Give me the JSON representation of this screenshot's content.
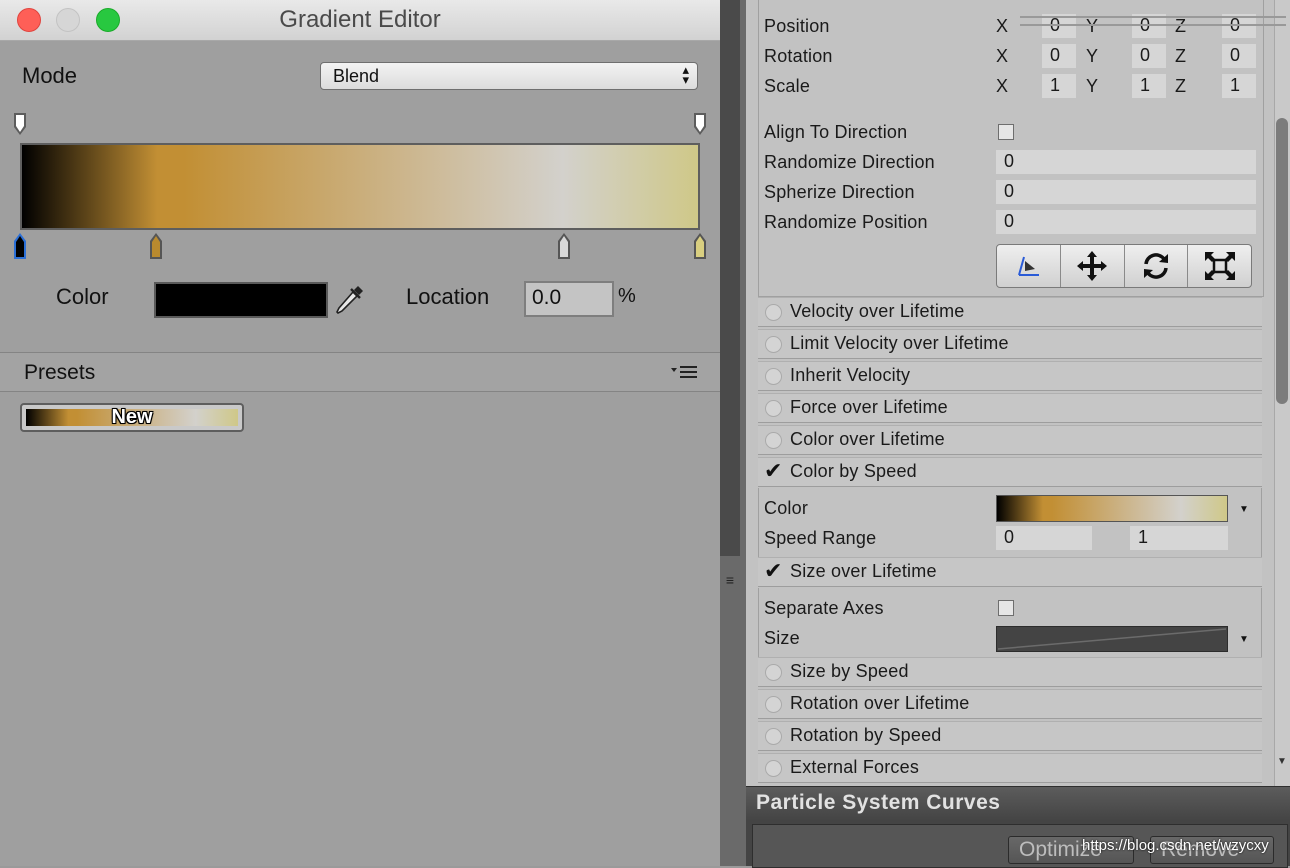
{
  "gradient_editor": {
    "title": "Gradient Editor",
    "mode_label": "Mode",
    "mode_value": "Blend",
    "color_label": "Color",
    "color_value": "#000000",
    "location_label": "Location",
    "location_value": "0.0",
    "percent_symbol": "%",
    "presets_label": "Presets",
    "preset_new_label": "New",
    "gradient_colors": [
      "#000000",
      "#c28f34",
      "#d3d1cc",
      "#cfc888"
    ],
    "color_keys": [
      "#000000",
      "#b98a2e",
      "#d8d8d8",
      "#d9cf80"
    ],
    "alpha_keys": [
      "#ffffff",
      "#ffffff"
    ]
  },
  "inspector": {
    "position": {
      "label": "Position",
      "x": "0",
      "y": "0",
      "z": "0"
    },
    "rotation": {
      "label": "Rotation",
      "x": "0",
      "y": "0",
      "z": "0"
    },
    "scale": {
      "label": "Scale",
      "x": "1",
      "y": "1",
      "z": "1"
    },
    "axis_labels": {
      "x": "X",
      "y": "Y",
      "z": "Z"
    },
    "align_to_direction": {
      "label": "Align To Direction",
      "checked": false
    },
    "randomize_direction": {
      "label": "Randomize Direction",
      "value": "0"
    },
    "spherize_direction": {
      "label": "Spherize Direction",
      "value": "0"
    },
    "randomize_position": {
      "label": "Randomize Position",
      "value": "0"
    },
    "tool_icons": [
      "shape-gizmo-icon",
      "move-icon",
      "rotate-icon",
      "scale-icon"
    ],
    "modules": [
      {
        "label": "Velocity over Lifetime",
        "enabled": false
      },
      {
        "label": "Limit Velocity over Lifetime",
        "enabled": false
      },
      {
        "label": "Inherit Velocity",
        "enabled": false
      },
      {
        "label": "Force over Lifetime",
        "enabled": false
      },
      {
        "label": "Color over Lifetime",
        "enabled": false
      },
      {
        "label": "Color by Speed",
        "enabled": true
      },
      {
        "label": "Size over Lifetime",
        "enabled": true
      },
      {
        "label": "Size by Speed",
        "enabled": false
      },
      {
        "label": "Rotation over Lifetime",
        "enabled": false
      },
      {
        "label": "Rotation by Speed",
        "enabled": false
      },
      {
        "label": "External Forces",
        "enabled": false
      }
    ],
    "color_by_speed": {
      "color_label": "Color",
      "speed_range_label": "Speed Range",
      "speed_range_min": "0",
      "speed_range_max": "1"
    },
    "size_over_lifetime": {
      "separate_axes_label": "Separate Axes",
      "separate_axes_checked": false,
      "size_label": "Size"
    }
  },
  "curves": {
    "title": "Particle System Curves",
    "optimize_button": "Optimize",
    "remove_button": "Remove"
  },
  "watermark": "https://blog.csdn.net/wzycxy"
}
